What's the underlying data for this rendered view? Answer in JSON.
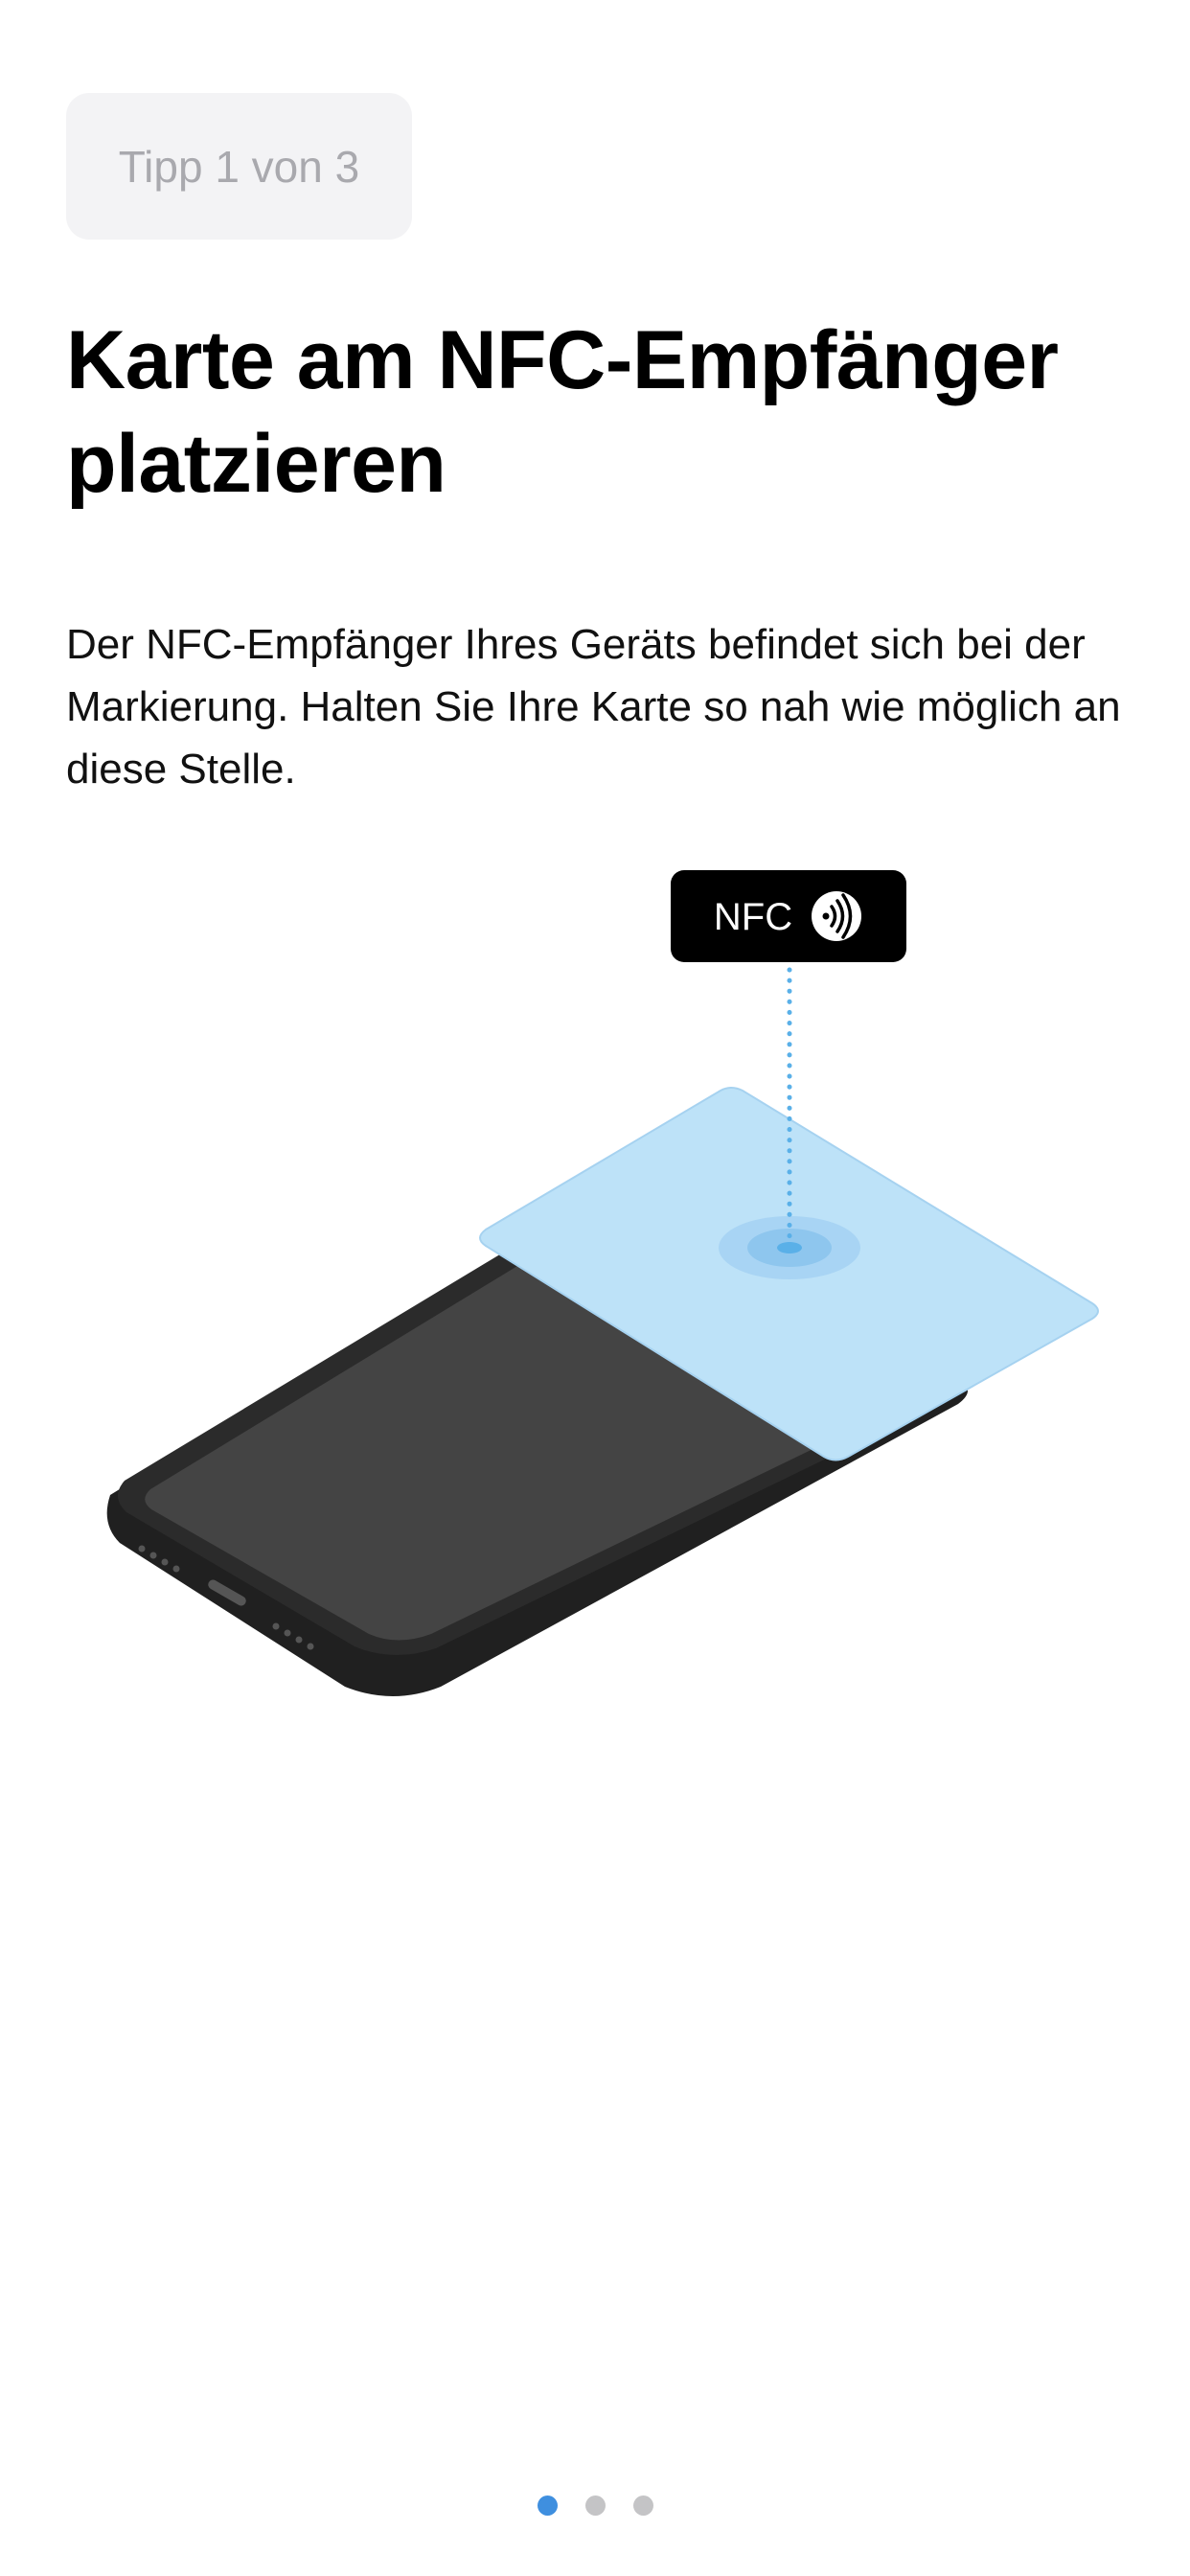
{
  "tip_badge": {
    "label": "Tipp 1 von 3"
  },
  "title": "Karte am NFC-Empfänger platzieren",
  "description": "Der NFC-Empfänger Ihres Geräts befindet sich bei der Markierung. Halten Sie Ihre Karte so nah wie möglich an diese Stelle.",
  "illustration": {
    "nfc_label": "NFC",
    "nfc_icon": "contactless-icon",
    "card_color": "#bde2f8",
    "phone_color": "#202020",
    "screen_color": "#444444",
    "marker_color": "#5ab0e8"
  },
  "pager": {
    "total": 3,
    "current": 1,
    "active_color": "#3f8fdf",
    "inactive_color": "#c4c4c6"
  }
}
